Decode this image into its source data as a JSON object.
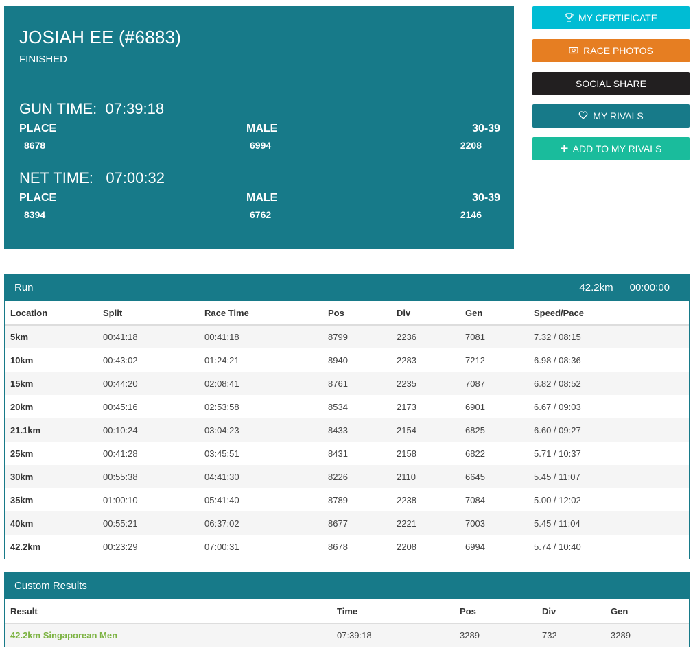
{
  "athlete": {
    "name": "JOSIAH EE (#6883)",
    "status": "FINISHED"
  },
  "gun_time": {
    "title": "GUN TIME:  07:39:18",
    "place_label": "PLACE",
    "place_value": "8678",
    "gender_label": "MALE",
    "gender_value": "6994",
    "division_label": "30-39",
    "division_value": "2208"
  },
  "net_time": {
    "title": "NET TIME:   07:00:32",
    "place_label": "PLACE",
    "place_value": "8394",
    "gender_label": "MALE",
    "gender_value": "6762",
    "division_label": "30-39",
    "division_value": "2146"
  },
  "buttons": {
    "certificate": "MY CERTIFICATE",
    "photos": "RACE PHOTOS",
    "share": "SOCIAL SHARE",
    "rivals": "MY RIVALS",
    "add_rivals": "ADD TO MY RIVALS"
  },
  "icons": {
    "certificate": "trophy-icon",
    "photos": "camera-icon",
    "rivals": "heart-icon",
    "add_rivals": "plus-icon"
  },
  "colors": {
    "teal": "#177a89",
    "cyan": "#00bcd4",
    "orange": "#e67e22",
    "dark": "#221f20",
    "green": "#1abc9c",
    "result_link": "#7cb342"
  },
  "run_panel": {
    "title": "Run",
    "distance": "42.2km",
    "time": "00:00:00",
    "headers": [
      "Location",
      "Split",
      "Race Time",
      "Pos",
      "Div",
      "Gen",
      "Speed/Pace"
    ],
    "rows": [
      [
        "5km",
        "00:41:18",
        "00:41:18",
        "8799",
        "2236",
        "7081",
        "7.32 / 08:15"
      ],
      [
        "10km",
        "00:43:02",
        "01:24:21",
        "8940",
        "2283",
        "7212",
        "6.98 / 08:36"
      ],
      [
        "15km",
        "00:44:20",
        "02:08:41",
        "8761",
        "2235",
        "7087",
        "6.82 / 08:52"
      ],
      [
        "20km",
        "00:45:16",
        "02:53:58",
        "8534",
        "2173",
        "6901",
        "6.67 / 09:03"
      ],
      [
        "21.1km",
        "00:10:24",
        "03:04:23",
        "8433",
        "2154",
        "6825",
        "6.60 / 09:27"
      ],
      [
        "25km",
        "00:41:28",
        "03:45:51",
        "8431",
        "2158",
        "6822",
        "5.71 / 10:37"
      ],
      [
        "30km",
        "00:55:38",
        "04:41:30",
        "8226",
        "2110",
        "6645",
        "5.45 / 11:07"
      ],
      [
        "35km",
        "01:00:10",
        "05:41:40",
        "8789",
        "2238",
        "7084",
        "5.00 / 12:02"
      ],
      [
        "40km",
        "00:55:21",
        "06:37:02",
        "8677",
        "2221",
        "7003",
        "5.45 / 11:04"
      ],
      [
        "42.2km",
        "00:23:29",
        "07:00:31",
        "8678",
        "2208",
        "6994",
        "5.74 / 10:40"
      ]
    ]
  },
  "custom_panel": {
    "title": "Custom Results",
    "headers": [
      "Result",
      "Time",
      "Pos",
      "Div",
      "Gen"
    ],
    "rows": [
      [
        "42.2km Singaporean Men",
        "07:39:18",
        "3289",
        "732",
        "3289"
      ]
    ]
  }
}
